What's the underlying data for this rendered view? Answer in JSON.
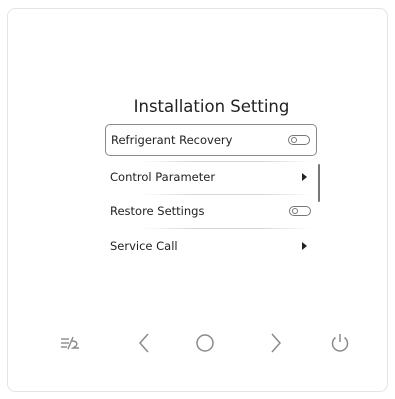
{
  "screen": {
    "title": "Installation Setting",
    "items": [
      {
        "label": "Refrigerant Recovery",
        "control": "toggle",
        "state": "off",
        "selected": true
      },
      {
        "label": "Control Parameter",
        "control": "submenu-arrow",
        "selected": false
      },
      {
        "label": "Restore Settings",
        "control": "toggle",
        "state": "off",
        "selected": false
      },
      {
        "label": "Service Call",
        "control": "submenu-arrow",
        "selected": false
      }
    ]
  },
  "buttons": [
    {
      "name": "mode-icon"
    },
    {
      "name": "left-chevron-icon"
    },
    {
      "name": "home-circle-icon"
    },
    {
      "name": "right-chevron-icon"
    },
    {
      "name": "power-icon"
    }
  ],
  "colors": {
    "panel_border": "#e4e4e4",
    "text": "#222222",
    "icon": "#8a8a8a",
    "selected_border": "#8a8a8a"
  }
}
